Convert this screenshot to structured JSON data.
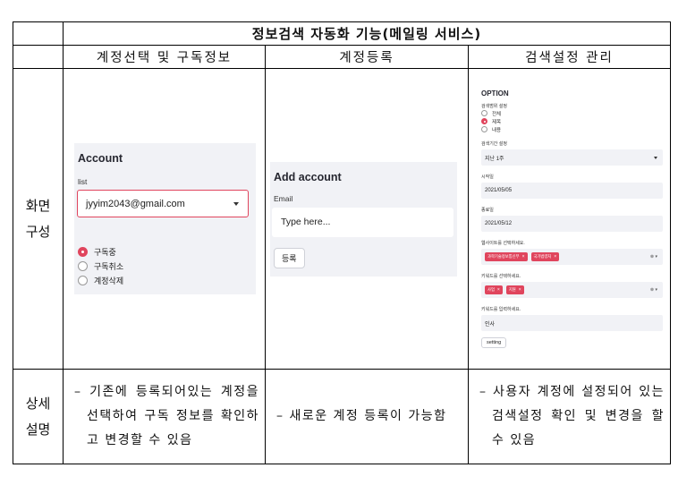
{
  "title": "정보검색 자동화 기능(메일링 서비스)",
  "columns": [
    "계정선택 및 구독정보",
    "계정등록",
    "검색설정 관리"
  ],
  "rows": {
    "screen_label_1": "화면",
    "screen_label_2": "구성",
    "detail_label_1": "상세",
    "detail_label_2": "설명"
  },
  "account_panel": {
    "title": "Account",
    "list_label": "list",
    "selected_email": "jyyim2043@gmail.com",
    "radio_options": [
      "구독중",
      "구독취소",
      "계정삭제"
    ],
    "selected_index": 0
  },
  "add_panel": {
    "title": "Add account",
    "email_label": "Email",
    "email_placeholder": "Type here...",
    "button_label": "등록"
  },
  "option_panel": {
    "title": "OPTION",
    "search_scope_label": "검색범위 설정",
    "scope_options": [
      "전체",
      "제목",
      "내용"
    ],
    "scope_selected_index": 1,
    "period_label": "검색기간 설정",
    "period_value": "지난 1주",
    "start_label": "시작일",
    "start_value": "2021/05/05",
    "end_label": "종료일",
    "end_value": "2021/05/12",
    "site_label": "웹사이트를 선택하세요.",
    "site_tags": [
      "과학기술정보통신부",
      "국가법령처"
    ],
    "keyword_select_label": "키워드를 선택하세요.",
    "keyword_tags": [
      "사업",
      "지원"
    ],
    "keyword_input_label": "키워드를 입력하세요.",
    "keyword_input_value": "인사",
    "setting_button": "setting",
    "tag_remove_glyph": "×",
    "control_glyph": "⊗ ▾"
  },
  "descriptions": [
    "– 기존에 등록되어있는 계정을 선택하여 구독 정보를 확인하고 변경할 수 있음",
    "– 새로운 계정 등록이 가능함",
    "– 사용자 계정에 설정되어 있는 검색설정 확인 및 변경을 할 수 있음"
  ],
  "colors": {
    "accent": "#e0455d",
    "panel_bg": "#f1f2f6"
  }
}
